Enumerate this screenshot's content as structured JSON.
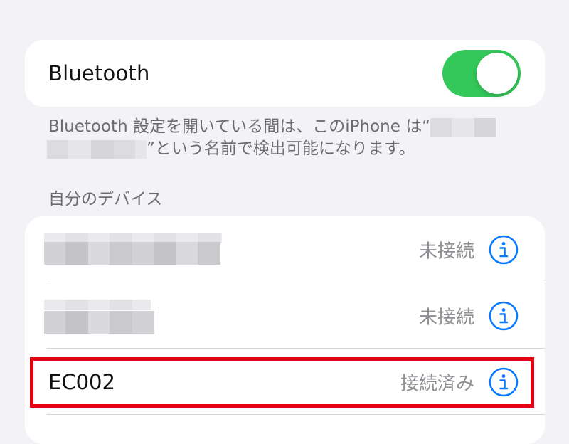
{
  "bluetooth": {
    "label": "Bluetooth",
    "toggle_on": true,
    "toggle_color": "#34c759"
  },
  "footnote": {
    "text_before": "Bluetooth 設定を開いている間は、このiPhone は“",
    "text_after": "”という名前で検出可能になります。"
  },
  "my_devices": {
    "header": "自分のデバイス",
    "devices": [
      {
        "name": "",
        "name_redacted": true,
        "status": "未接続",
        "info_icon": "info-circle-icon"
      },
      {
        "name": "",
        "name_redacted": true,
        "status": "未接続",
        "info_icon": "info-circle-icon"
      },
      {
        "name": "EC002",
        "name_redacted": false,
        "status": "接続済み",
        "info_icon": "info-circle-icon",
        "highlighted": true
      }
    ]
  },
  "colors": {
    "accent": "#0a7aff",
    "highlight": "#e60012",
    "secondary_text": "#8e8e93"
  }
}
